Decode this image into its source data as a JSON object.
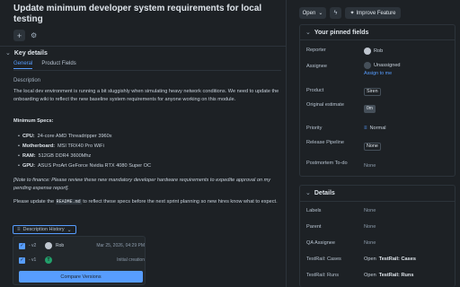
{
  "issue": {
    "title": "Update minimum developer system requirements for local testing"
  },
  "key_details": {
    "label": "Key details",
    "tabs": [
      {
        "label": "General"
      },
      {
        "label": "Product Fields"
      }
    ],
    "description_label": "Description",
    "description_intro": "The local dev environment is running a bit sluggishly when simulating heavy network conditions. We need to update the onboarding wiki to reflect the new baseline system requirements for anyone working on this module.",
    "min_specs_heading": "Minimum Specs:",
    "specs": [
      {
        "key": "CPU:",
        "value": "24-core AMD Threadripper 3960x"
      },
      {
        "key": "Motherboard:",
        "value": "MSI TRX40 Pro WiFi"
      },
      {
        "key": "RAM:",
        "value": "512GB DDR4 3600Mhz"
      },
      {
        "key": "GPU:",
        "value": "ASUS ProArt GeForce Nvidia RTX 4080 Super OC"
      }
    ],
    "finance_note": "[Note to finance: Please review these new mandatory developer hardware requirements to expedite approval on my pending expense report].",
    "update_pre": "Please update the",
    "update_code": "README.md",
    "update_post": "to reflect these specs before the next sprint planning so new hires know what to expect."
  },
  "description_history": {
    "toggle_label": "Description History",
    "rows": [
      {
        "version": "- v2",
        "author": "Rob",
        "date": "Mar 25, 2026, 04:29 PM",
        "checked": "✓",
        "avatar_color": "#c0c7d0"
      },
      {
        "version": "- v1",
        "author": "",
        "date": "Initial creation",
        "checked": "✓",
        "avatar_color": "#22a06b",
        "avatar_letter": "T"
      }
    ],
    "compare_label": "Compare Versions"
  },
  "toolbar": {
    "open_label": "Open",
    "improve_label": "Improve Feature"
  },
  "pinned": {
    "label": "Your pinned fields",
    "fields": {
      "reporter_label": "Reporter",
      "reporter_value": "Rob",
      "assignee_label": "Assignee",
      "assignee_value": "Unassigned",
      "assign_to_me": "Assign to me",
      "product_label": "Product",
      "product_value": "Siren",
      "original_estimate_label": "Original estimate",
      "original_estimate_value": "0m",
      "priority_label": "Priority",
      "priority_value": "Normal",
      "release_pipeline_label": "Release Pipeline",
      "release_pipeline_value": "None",
      "postmortem_label": "Postmortem To-do",
      "postmortem_value": "None"
    }
  },
  "details": {
    "label": "Details",
    "fields": {
      "labels_label": "Labels",
      "labels_value": "None",
      "parent_label": "Parent",
      "parent_value": "None",
      "qa_label": "QA Assignee",
      "qa_value": "None",
      "cases_label": "TestRail: Cases",
      "cases_open": "Open",
      "cases_value": "TestRail: Cases",
      "runs_label": "TestRail: Runs",
      "runs_open": "Open",
      "runs_value": "TestRail: Runs"
    }
  },
  "colors": {
    "background": "#1d2125",
    "accent": "#579dff",
    "border": "#2c333a"
  },
  "icons": [
    "plus-icon",
    "gear-icon",
    "chevron-down-icon",
    "bolt-icon",
    "sparkle-icon",
    "history-icon",
    "priority-icon",
    "avatar-icon"
  ]
}
